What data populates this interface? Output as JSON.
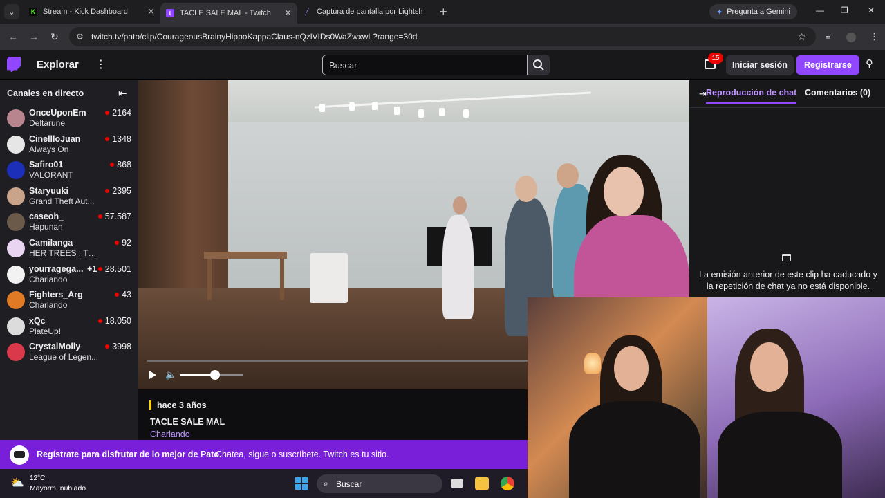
{
  "browser": {
    "tabs": [
      {
        "title": "Stream - Kick Dashboard",
        "favicon": "kick-icon",
        "color": "#53fc18"
      },
      {
        "title": "TACLE SALE MAL - Twitch",
        "favicon": "twitch-icon",
        "color": "#9147ff",
        "active": true
      },
      {
        "title": "Captura de pantalla por Lightsh",
        "favicon": "lightshot-feather-icon",
        "color": "#a38bff"
      }
    ],
    "gemini_label": "Pregunta a Gemini",
    "url": "twitch.tv/pato/clip/CourageousBrainyHippoKappaClaus-nQzlVIDs0WaZwxwL?range=30d"
  },
  "twitch_nav": {
    "explore": "Explorar",
    "search_placeholder": "Buscar",
    "notifications_count": "15",
    "login": "Iniciar sesión",
    "register": "Registrarse",
    "accent": "#9147ff"
  },
  "sidebar": {
    "header": "Canales en directo",
    "channels": [
      {
        "name": "OnceUponEm",
        "game": "Deltarune",
        "viewers": "2164",
        "avatar_color": "#b8858f"
      },
      {
        "name": "CinellloJuan",
        "game": "Always On",
        "viewers": "1348",
        "avatar_color": "#e6e6e6"
      },
      {
        "name": "Safiro01",
        "game": "VALORANT",
        "viewers": "868",
        "avatar_color": "#1b2fb8"
      },
      {
        "name": "Staryuuki",
        "game": "Grand Theft Aut...",
        "viewers": "2395",
        "avatar_color": "#c9a48a"
      },
      {
        "name": "caseoh_",
        "game": "Hapunan",
        "viewers": "57.587",
        "avatar_color": "#6b5a4a"
      },
      {
        "name": "Camilanga",
        "game": "HER TREES : THE...",
        "viewers": "92",
        "avatar_color": "#e9d4f1"
      },
      {
        "name": "yourragega...",
        "extra": "+1",
        "game": "Charlando",
        "viewers": "28.501",
        "avatar_color": "#f2f2f2"
      },
      {
        "name": "Fighters_Arg",
        "game": "Charlando",
        "viewers": "43",
        "avatar_color": "#e07a24"
      },
      {
        "name": "xQc",
        "game": "PlateUp!",
        "viewers": "18.050",
        "avatar_color": "#dcdcdc"
      },
      {
        "name": "CrystalMolly",
        "game": "League of Legen...",
        "viewers": "3998",
        "avatar_color": "#d9394a"
      }
    ]
  },
  "clip": {
    "ago": "hace 3 años",
    "title": "TACLE SALE MAL",
    "category": "Charlando",
    "volume": 0.55
  },
  "chat": {
    "tab_replay": "Reproducción de chat",
    "tab_comments": "Comentarios (0)",
    "message": "La emisión anterior de este clip ha caducado y la repetición de chat ya no está disponible."
  },
  "banner": {
    "bold": "Regístrate para disfrutar de lo mejor de Pato.",
    "text": "Chatea, sigue o suscríbete. Twitch es tu sitio."
  },
  "taskbar": {
    "temperature": "12°C",
    "condition": "Mayorm. nublado",
    "search": "Buscar"
  }
}
